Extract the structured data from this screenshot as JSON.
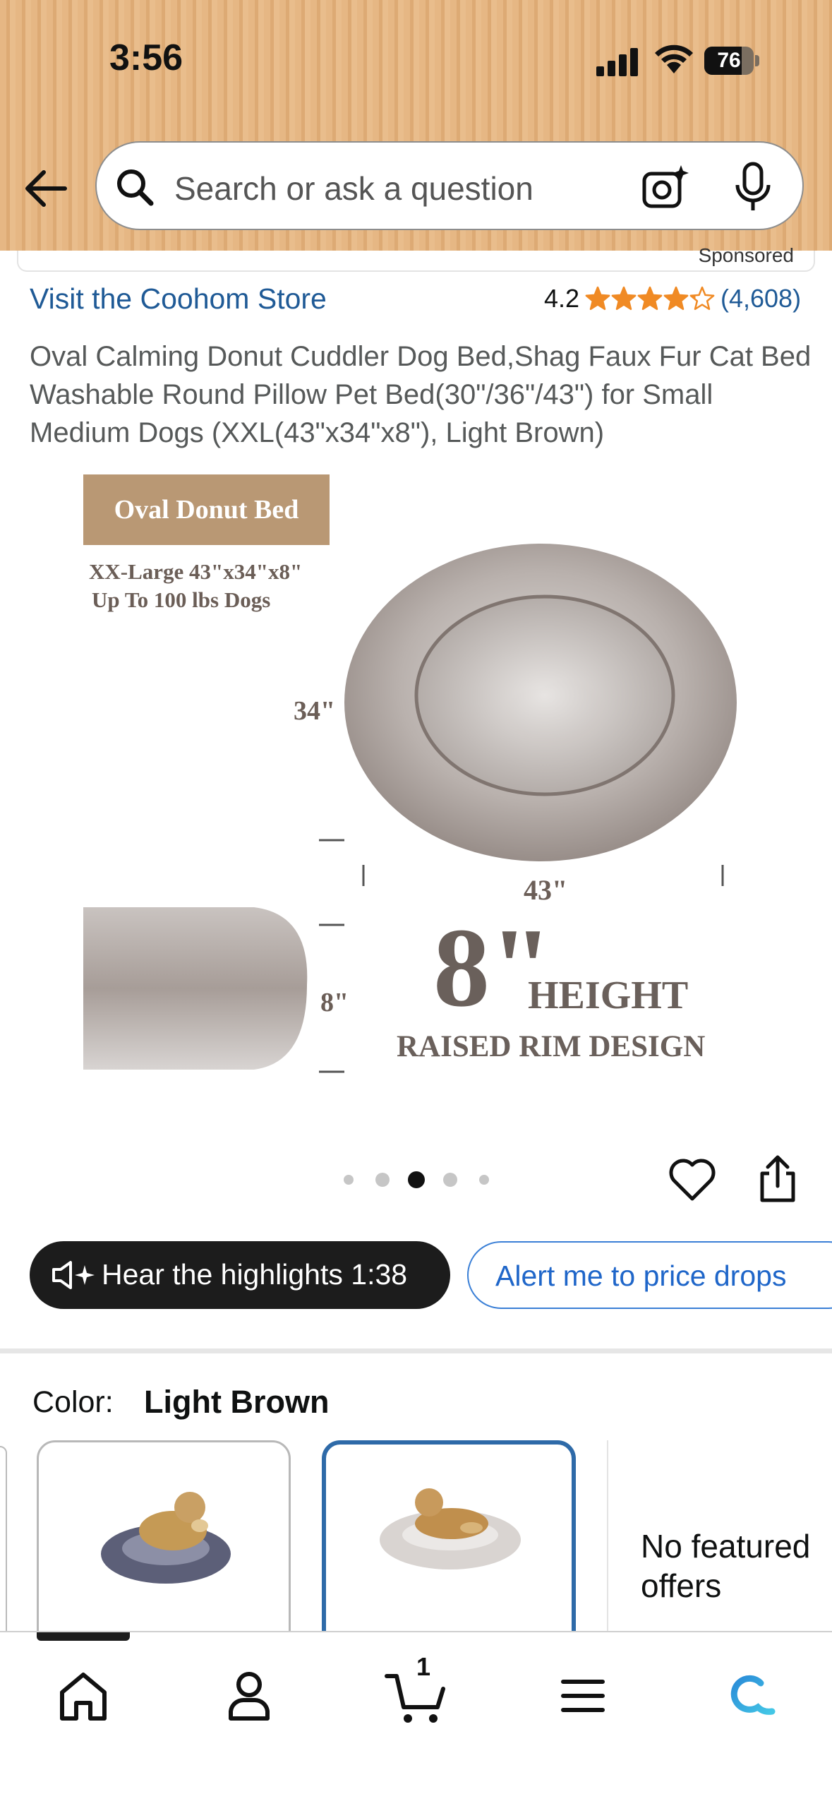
{
  "status_bar": {
    "time": "3:56",
    "battery": "76",
    "battery_level": 0.76
  },
  "search": {
    "placeholder": "Search or ask a question"
  },
  "previous_item": {
    "sponsored": "Sponsored"
  },
  "product": {
    "store_link": "Visit the Coohom Store",
    "rating": "4.2",
    "stars_value": 4.2,
    "rating_count": "(4,608)",
    "title": "Oval Calming Donut Cuddler Dog Bed,Shag Faux Fur Cat Bed Washable Round Pillow Pet Bed(30\"/36\"/43\") for Small Medium Dogs (XXL(43\"x34\"x8\"), Light Brown)"
  },
  "image_overlay": {
    "tag": "Oval Donut Bed",
    "size_line1": "XX-Large 43\"x34\"x8\"",
    "size_line2": "Up To 100 lbs Dogs",
    "dim_width": "34\"",
    "dim_length": "43\"",
    "dim_height": "8\"",
    "big_number": "8\"",
    "height_word": "HEIGHT",
    "rim_text": "RAISED RIM DESIGN"
  },
  "carousel": {
    "count": 5,
    "active_index": 2
  },
  "actions": {
    "hear_highlights": "Hear the highlights 1:38",
    "price_alert": "Alert me to price drops"
  },
  "color": {
    "label": "Color:",
    "value": "Light Brown",
    "swatches": [
      "Grey",
      "Light Brown"
    ],
    "selected_index": 1,
    "no_offers": "No featured offers"
  },
  "tabbar": {
    "items": [
      "home-icon",
      "account-icon",
      "cart-icon",
      "menu-icon",
      "rufus-icon"
    ],
    "cart_count": "1"
  },
  "colors": {
    "header_bg": "#e6b784",
    "link": "#1f5a96",
    "star": "#f08a24",
    "selected_border": "#2e6aa8",
    "alert_blue": "#1f66c9"
  }
}
